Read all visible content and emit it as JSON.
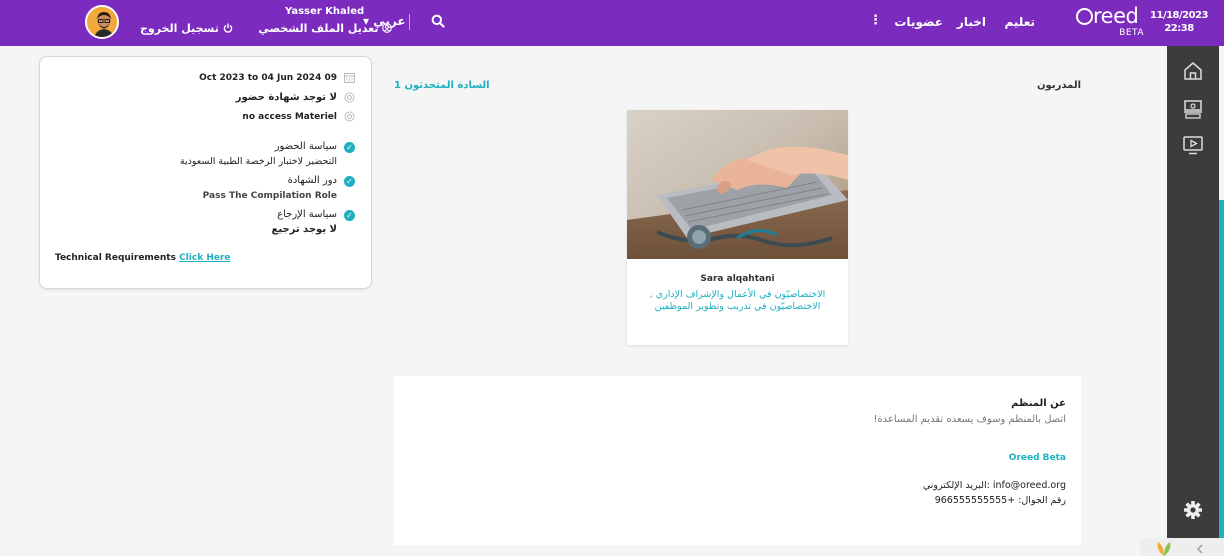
{
  "header": {
    "date": "11/18/2023",
    "time": "22:38",
    "logo_text": "reed",
    "logo_badge": "BETA",
    "nav_learn": "تعليم",
    "nav_news": "اخبار",
    "nav_memberships": "عضويات",
    "more_glyph": "⋮",
    "language": "عربي",
    "language_chevron": "▾",
    "user_name": "Yasser Khaled",
    "edit_profile": "تعديل الملف الشخصي",
    "logout": "تسجيل الخروج",
    "brand_color": "#7b2cbf"
  },
  "course_info": {
    "dates": "Oct 2023 to 04 Jun 2024 09",
    "attendance_certificate": "لا توجد شهادة حضور",
    "material_access": "no access Materiel",
    "attendance_policy_label": "سياسة الحضور",
    "attendance_policy_value": "التحضير لاختبار الرخصة الطبية السعودية",
    "certificate_role_label": "دور الشهادة",
    "certificate_role_value": "Pass The Compilation Role",
    "refund_policy_label": "سياسة الإرجاع",
    "refund_policy_value": "لا يوجد ترجيع",
    "tech_requirements": "Technical Requirements",
    "tech_link": "Click Here",
    "accent_color": "#1fb0bf"
  },
  "trainers": {
    "title": "المدربون",
    "speakers_link": "1 السادة المتحدثون",
    "speaker_name": "Sara alqahtani",
    "speaker_title": "الاختصاصيّون في الأعمال والإشراف الإداري , الاختصاصيّون في تدريب وتطوير الموظفين"
  },
  "organizer": {
    "title": "عن المنظم",
    "description": "اتصل بالمنظم وسوف يسعده تقديم المساعدة!",
    "name": "Oreed Beta",
    "email": "البريد الإلكتروني: info@oreed.org",
    "phone": "رقم الجوال: +966555555555"
  }
}
